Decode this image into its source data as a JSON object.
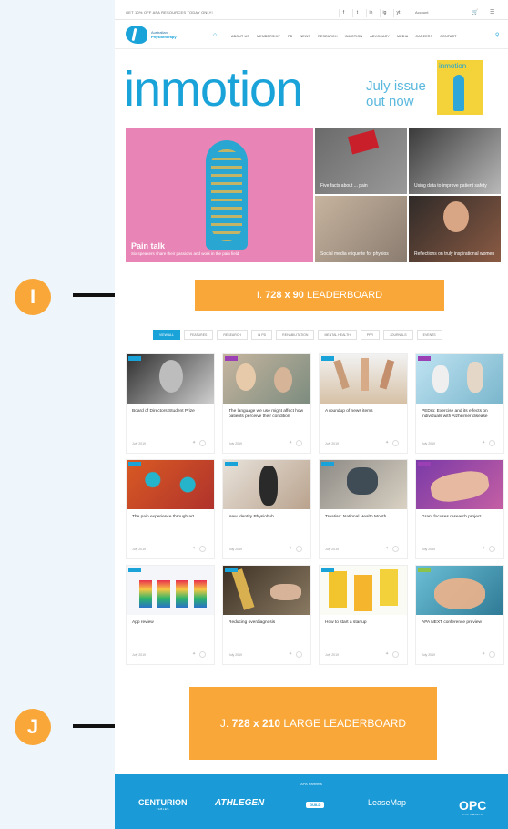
{
  "topbar": {
    "message": "GET 10% OFF APA RESOURCES TODAY ONLY!",
    "account": "Account",
    "socials": [
      "f",
      "t",
      "in",
      "ig",
      "yt"
    ]
  },
  "nav": {
    "links": [
      "ABOUT US",
      "MEMBERSHIP",
      "PD",
      "NEWS",
      "RESEARCH",
      "INMOTION",
      "ADVOCACY",
      "MEDIA",
      "CAREERS",
      "CONTACT"
    ]
  },
  "hero": {
    "mag_title": "inmotion",
    "issue": "July issue out now",
    "cover_title": "inmotion"
  },
  "features": {
    "big_title": "Pain talk",
    "big_sub": "Six speakers share their passions and work in the pain field",
    "a": "Five facts about ... pain",
    "b": "Using data to improve patient safety",
    "c": "Social media etiquette for physios",
    "d": "Reflections on truly inspirational women"
  },
  "ads": {
    "top_prefix": "I.",
    "top_size": "728 x 90",
    "top_label": "LEADERBOARD",
    "bottom_prefix": "J.",
    "bottom_size": "728 x 210",
    "bottom_label": "LARGE LEADERBOARD"
  },
  "filters": [
    "VIEW ALL",
    "FEATURES",
    "RESEARCH",
    "IN PD",
    "REHABILITATION",
    "MENTAL HEALTH",
    "PPR",
    "JOURNALS",
    "EVENTS"
  ],
  "cards": [
    {
      "title": "Board of Directors Student Prize",
      "date": "July 2019",
      "tag_color": "#1aa3d9"
    },
    {
      "title": "The language we use might affect how patients perceive their condition",
      "date": "July 2019",
      "tag_color": "#9b3fb5"
    },
    {
      "title": "A roundup of news items",
      "date": "July 2019",
      "tag_color": "#1aa3d9"
    },
    {
      "title": "PEDro: Exercise and its effects on individuals with Alzheimer disease",
      "date": "July 2019",
      "tag_color": "#9b3fb5"
    },
    {
      "title": "The pain experience through art",
      "date": "July 2019",
      "tag_color": "#1aa3d9"
    },
    {
      "title": "New identity Physiohub",
      "date": "July 2019",
      "tag_color": "#1aa3d9"
    },
    {
      "title": "Treatise: National Health Month",
      "date": "July 2019",
      "tag_color": "#1aa3d9"
    },
    {
      "title": "Grant focuses research project",
      "date": "July 2019",
      "tag_color": "#9b3fb5"
    },
    {
      "title": "App review",
      "date": "July 2019",
      "tag_color": "#1aa3d9"
    },
    {
      "title": "Reducing overdiagnosis",
      "date": "July 2019",
      "tag_color": "#1aa3d9"
    },
    {
      "title": "How to start a startup",
      "date": "July 2019",
      "tag_color": "#1aa3d9"
    },
    {
      "title": "APA NEXT conference preview",
      "date": "July 2019",
      "tag_color": "#8bc34a"
    }
  ],
  "footer": {
    "heading": "APA Partners",
    "partners": [
      "CENTURION",
      "ATHLEGEN",
      "GUILD",
      "LeaseMap",
      "OPC"
    ],
    "centurion_sub": "TABLES",
    "opc_sub": "OTC HEALTH"
  },
  "annotations": {
    "i": "I",
    "j": "J"
  },
  "colors": {
    "accent": "#1aa3d9",
    "ad": "#f9a739",
    "footer": "#1a9bd7"
  }
}
